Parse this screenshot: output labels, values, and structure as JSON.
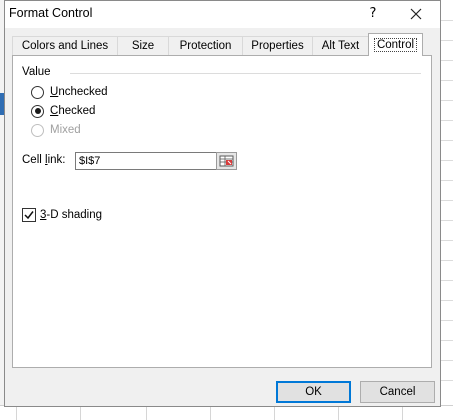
{
  "dialog": {
    "title": "Format Control",
    "help_label": "?",
    "close_label": "✕"
  },
  "tabs": [
    {
      "label": "Colors and Lines",
      "active": false
    },
    {
      "label": "Size",
      "active": false
    },
    {
      "label": "Protection",
      "active": false
    },
    {
      "label": "Properties",
      "active": false
    },
    {
      "label": "Alt Text",
      "active": false
    },
    {
      "label": "Control",
      "active": true
    }
  ],
  "value_group": {
    "label": "Value",
    "options": [
      {
        "label": "Unchecked",
        "mnemonic": "U",
        "selected": false,
        "disabled": false
      },
      {
        "label": "Checked",
        "mnemonic": "C",
        "selected": true,
        "disabled": false
      },
      {
        "label": "Mixed",
        "mnemonic": "",
        "selected": false,
        "disabled": true
      }
    ]
  },
  "cell_link": {
    "label": "Cell link:",
    "value": "$I$7"
  },
  "shading": {
    "label": "3-D shading",
    "checked": true
  },
  "buttons": {
    "ok": "OK",
    "cancel": "Cancel"
  },
  "colors": {
    "accent": "#0078d7",
    "panel": "#ffffff",
    "dialog_bg": "#f0f0f0"
  },
  "icons": {
    "refedit": "range-select-icon",
    "checkmark": "checkmark-icon"
  }
}
